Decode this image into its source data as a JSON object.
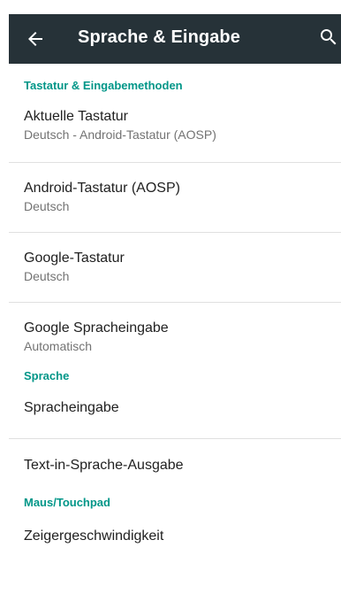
{
  "toolbar": {
    "title": "Sprache & Eingabe",
    "back_icon": "arrow-back-icon",
    "search_icon": "search-icon",
    "background_color": "#263238"
  },
  "sections": {
    "keyboard": {
      "header": "Tastatur & Eingabemethoden",
      "items": [
        {
          "title": "Aktuelle Tastatur",
          "summary": "Deutsch - Android-Tastatur (AOSP)"
        },
        {
          "title": "Android-Tastatur (AOSP)",
          "summary": "Deutsch"
        },
        {
          "title": "Google-Tastatur",
          "summary": "Deutsch"
        },
        {
          "title": "Google Spracheingabe",
          "summary": "Automatisch"
        }
      ]
    },
    "speech": {
      "header": "Sprache",
      "items": [
        {
          "title": "Spracheingabe"
        },
        {
          "title": "Text-in-Sprache-Ausgabe"
        }
      ]
    },
    "mouse": {
      "header": "Maus/Touchpad",
      "items": [
        {
          "title": "Zeigergeschwindigkeit"
        }
      ]
    }
  },
  "colors": {
    "accent": "#009688",
    "divider": "#e0e0e0"
  }
}
